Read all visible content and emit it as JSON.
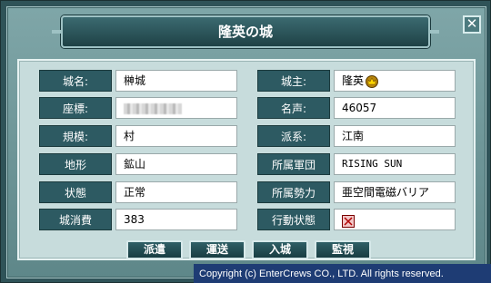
{
  "window": {
    "title": "隆英の城",
    "close_label": "✕"
  },
  "fields_left": [
    {
      "label": "城名:",
      "value": "榊城"
    },
    {
      "label": "座標:",
      "value": "",
      "blurred": true
    },
    {
      "label": "規模:",
      "value": "村"
    },
    {
      "label": "地形",
      "value": "鉱山"
    },
    {
      "label": "状態",
      "value": "正常"
    },
    {
      "label": "城消費",
      "value": "383"
    }
  ],
  "fields_right": [
    {
      "label": "城主:",
      "value": "隆英",
      "icon": "crown-icon"
    },
    {
      "label": "名声:",
      "value": "46057"
    },
    {
      "label": "派系:",
      "value": "江南"
    },
    {
      "label": "所属軍団",
      "value": "RISING  SUN"
    },
    {
      "label": "所属勢力",
      "value": "亜空間電磁バリア"
    },
    {
      "label": "行動状態",
      "value": "",
      "icon": "status-icon"
    }
  ],
  "buttons": [
    "派遣",
    "運送",
    "入城",
    "監視"
  ],
  "footer": {
    "copyright": "Copyright (c) EnterCrews CO., LTD. All rights reserved."
  },
  "colors": {
    "label_bg": "#2d5a62",
    "panel_bg": "#c7dcdc",
    "footer_bg": "#1e3c74"
  }
}
